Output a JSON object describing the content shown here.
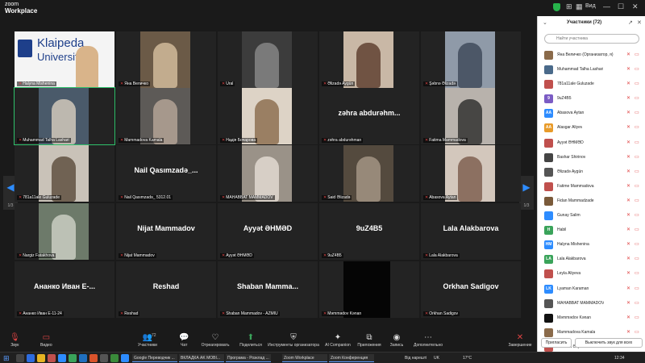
{
  "app": {
    "brand_line1": "zoom",
    "brand_line2": "Workplace",
    "view_label": "Вид"
  },
  "colors": {
    "accent": "#2d8cff",
    "speaking": "#2fc26b",
    "muted": "#e04444"
  },
  "gallery": {
    "page_indicator_left": "1/3",
    "page_indicator_right": "1/3",
    "tiles": [
      {
        "name": "Halyna Mishenina",
        "display": "",
        "kind": "slide"
      },
      {
        "name": "Яна Величко",
        "display": "",
        "kind": "video"
      },
      {
        "name": "Ural",
        "display": "",
        "kind": "video"
      },
      {
        "name": "Əlizadə Aygün",
        "display": "",
        "kind": "video"
      },
      {
        "name": "Şəbnə Əlizadə",
        "display": "",
        "kind": "video"
      },
      {
        "name": "Muhammad Talha Lashari",
        "display": "",
        "kind": "video"
      },
      {
        "name": "Mammadova Kamala",
        "display": "",
        "kind": "video"
      },
      {
        "name": "Надія Бочарова",
        "display": "",
        "kind": "video"
      },
      {
        "name": "zəhra abdurəhman",
        "display": "zəhra abdurəhm...",
        "kind": "name"
      },
      {
        "name": "Fatima Mammadova",
        "display": "",
        "kind": "video"
      },
      {
        "name": "781a11ale Guluzade",
        "display": "",
        "kind": "video"
      },
      {
        "name": "Nail Qasımzadə_ 5312.01",
        "display": "Nail Qasımzadə_...",
        "kind": "name"
      },
      {
        "name": "MAHABBAT MAMMADOV",
        "display": "",
        "kind": "video"
      },
      {
        "name": "Said Əlizadə",
        "display": "",
        "kind": "video"
      },
      {
        "name": "Abasova Aytan",
        "display": "",
        "kind": "video"
      },
      {
        "name": "Nargiz Fatakhova",
        "display": "",
        "kind": "video"
      },
      {
        "name": "Nijat Mammadov",
        "display": "Nijat Mammadov",
        "kind": "name"
      },
      {
        "name": "Ayyət ƏHMƏD",
        "display": "Ayyət ƏHMƏD",
        "kind": "name"
      },
      {
        "name": "9uZ4B5",
        "display": "9uZ4B5",
        "kind": "name"
      },
      {
        "name": "Lala Alakbarova",
        "display": "Lala Alakbarova",
        "kind": "name"
      },
      {
        "name": "Ананко Иван Е-11-24",
        "display": "Ананко Иван Е-...",
        "kind": "name"
      },
      {
        "name": "Reshad",
        "display": "Reshad",
        "kind": "name"
      },
      {
        "name": "Shaban Mammadov - AZMIU",
        "display": "Shaban Mamma...",
        "kind": "name"
      },
      {
        "name": "Məmmədov Kənan",
        "display": "",
        "kind": "dark"
      },
      {
        "name": "Orkhan Sadigov",
        "display": "Orkhan Sadigov",
        "kind": "name"
      }
    ]
  },
  "slide": {
    "line1": "Klaipeda",
    "line2": "University"
  },
  "toolbar": {
    "audio": "Звук",
    "video": "Видео",
    "participants": "Участники",
    "participants_count": "72",
    "chat": "Чат",
    "react": "Отреагировать",
    "share": "Поделиться",
    "apps_org": "Инструменты организатора",
    "ai": "AI Companion",
    "apps": "Приложения",
    "record": "Запись",
    "more": "Дополнительно",
    "end": "Завершение"
  },
  "panel": {
    "title": "Участники (72)",
    "search_placeholder": "Найти участника",
    "invite": "Пригласить",
    "mute_all": "Выключить звук для всех",
    "participants": [
      {
        "name": "Яна Величко (Организатор, я)",
        "initials": "",
        "color": "#8a6a4a"
      },
      {
        "name": "Muhammad Talha Lashari",
        "initials": "",
        "color": "#4a6a8a"
      },
      {
        "name": "781a11ale Guluzade",
        "initials": "",
        "color": "#c0504d"
      },
      {
        "name": "9uZ4B5",
        "initials": "9",
        "color": "#7b5cc4"
      },
      {
        "name": "Abasova Aytan",
        "initials": "AA",
        "color": "#2d8cff"
      },
      {
        "name": "Alasgar Aliyev",
        "initials": "AA",
        "color": "#e89b2a"
      },
      {
        "name": "Ayyət ƏHMƏD",
        "initials": "",
        "color": "#c0504d"
      },
      {
        "name": "Bashar Shirinov",
        "initials": "",
        "color": "#444"
      },
      {
        "name": "Əlizadə Aygün",
        "initials": "",
        "color": "#555"
      },
      {
        "name": "Fatime Mammadova",
        "initials": "",
        "color": "#c0504d"
      },
      {
        "name": "Fidan Mammadzade",
        "initials": "",
        "color": "#7a5a3a"
      },
      {
        "name": "Gunay Salim",
        "initials": "",
        "color": "#2d8cff"
      },
      {
        "name": "Habil",
        "initials": "H",
        "color": "#3aa35a"
      },
      {
        "name": "Halyna Mishenina",
        "initials": "HM",
        "color": "#2d8cff"
      },
      {
        "name": "Lala Alakbarova",
        "initials": "LA",
        "color": "#3aa35a"
      },
      {
        "name": "Leyla Aliyeva",
        "initials": "",
        "color": "#c0504d"
      },
      {
        "name": "Lyaman Karaman",
        "initials": "LK",
        "color": "#2d8cff"
      },
      {
        "name": "MAHABBAT MAMMADOV",
        "initials": "",
        "color": "#555"
      },
      {
        "name": "Məmmədov Kənan",
        "initials": "",
        "color": "#111"
      },
      {
        "name": "Mammadova Kamala",
        "initials": "",
        "color": "#8a6a4a"
      },
      {
        "name": "Metanet Əliyeva",
        "initials": "MƏ",
        "color": "#c0504d"
      }
    ]
  },
  "taskbar": {
    "items": [
      "Google Переводчик ...",
      "ВКЛАДКА AK MOBI...",
      "Програма - Розклад ...",
      "Zoom Workplace",
      "Zoom Конференция"
    ],
    "weather": "Від нарешті",
    "lang": "UK",
    "temp": "17°C",
    "time": "12:34"
  }
}
